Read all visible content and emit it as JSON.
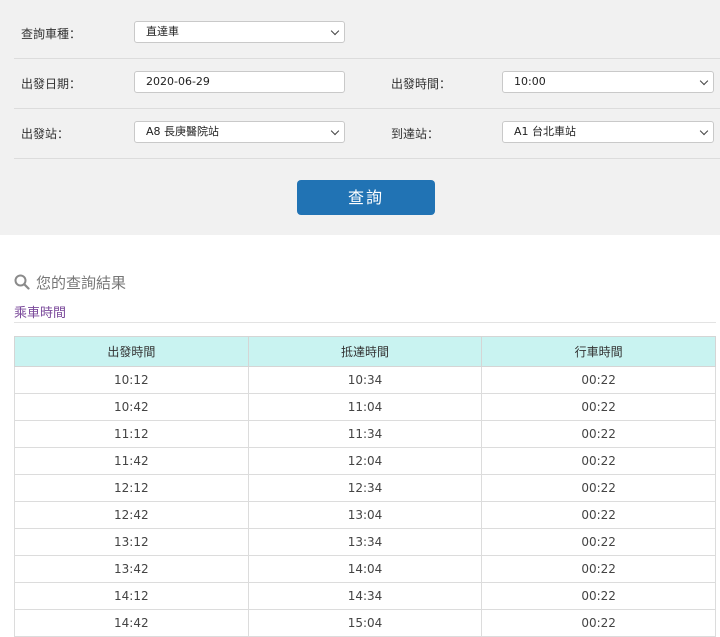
{
  "form": {
    "train_type": {
      "label": "查詢車種：",
      "value": "直達車"
    },
    "date": {
      "label": "出發日期：",
      "value": "2020-06-29"
    },
    "time": {
      "label": "出發時間：",
      "value": "10:00"
    },
    "origin": {
      "label": "出發站：",
      "value": "A8 長庚醫院站"
    },
    "destination": {
      "label": "到達站：",
      "value": "A1 台北車站"
    },
    "submit_label": "查詢"
  },
  "results": {
    "title": "您的查詢結果",
    "subtitle": "乘車時間",
    "columns": [
      "出發時間",
      "抵達時間",
      "行車時間"
    ],
    "rows": [
      [
        "10:12",
        "10:34",
        "00:22"
      ],
      [
        "10:42",
        "11:04",
        "00:22"
      ],
      [
        "11:12",
        "11:34",
        "00:22"
      ],
      [
        "11:42",
        "12:04",
        "00:22"
      ],
      [
        "12:12",
        "12:34",
        "00:22"
      ],
      [
        "12:42",
        "13:04",
        "00:22"
      ],
      [
        "13:12",
        "13:34",
        "00:22"
      ],
      [
        "13:42",
        "14:04",
        "00:22"
      ],
      [
        "14:12",
        "14:34",
        "00:22"
      ],
      [
        "14:42",
        "15:04",
        "00:22"
      ]
    ]
  },
  "colors": {
    "button": "#2173b4",
    "table_header": "#c9f3f1",
    "subtitle": "#7b4a9b"
  }
}
